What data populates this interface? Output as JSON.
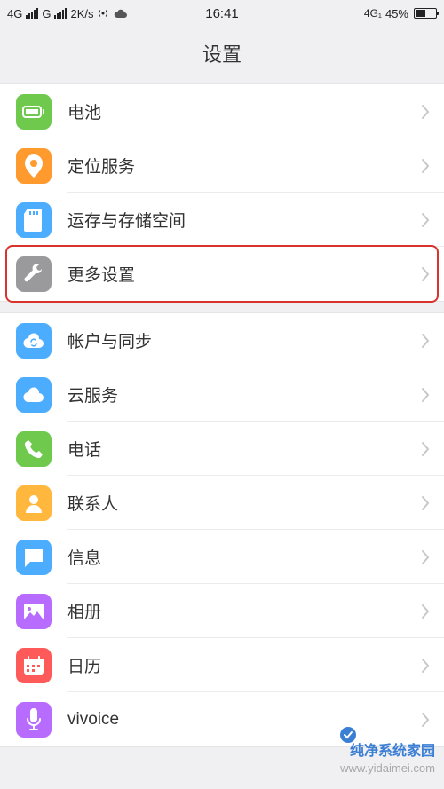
{
  "status": {
    "net1": "4G",
    "net2": "G",
    "speed": "2K/s",
    "time": "16:41",
    "net3": "4G₁",
    "battery_pct": "45%"
  },
  "header": {
    "title": "设置"
  },
  "groups": [
    {
      "items": [
        {
          "id": "battery",
          "label": "电池",
          "bg": "#6ec94d",
          "highlighted": false
        },
        {
          "id": "location",
          "label": "定位服务",
          "bg": "#ff9b2e",
          "highlighted": false
        },
        {
          "id": "storage",
          "label": "运存与存储空间",
          "bg": "#4cadff",
          "highlighted": false
        },
        {
          "id": "more-settings",
          "label": "更多设置",
          "bg": "#9a9a9d",
          "highlighted": true
        }
      ]
    },
    {
      "items": [
        {
          "id": "accounts",
          "label": "帐户与同步",
          "bg": "#4cadff",
          "highlighted": false
        },
        {
          "id": "cloud",
          "label": "云服务",
          "bg": "#4cadff",
          "highlighted": false
        },
        {
          "id": "phone",
          "label": "电话",
          "bg": "#6ec94d",
          "highlighted": false
        },
        {
          "id": "contacts",
          "label": "联系人",
          "bg": "#ffb83d",
          "highlighted": false
        },
        {
          "id": "messages",
          "label": "信息",
          "bg": "#4cadff",
          "highlighted": false
        },
        {
          "id": "gallery",
          "label": "相册",
          "bg": "#b86cff",
          "highlighted": false
        },
        {
          "id": "calendar",
          "label": "日历",
          "bg": "#ff5a5a",
          "highlighted": false
        },
        {
          "id": "vivoice",
          "label": "vivoice",
          "bg": "#b86cff",
          "highlighted": false
        }
      ]
    }
  ],
  "watermark": {
    "brand": "纯净系统家园",
    "url": "www.yidaimei.com"
  }
}
